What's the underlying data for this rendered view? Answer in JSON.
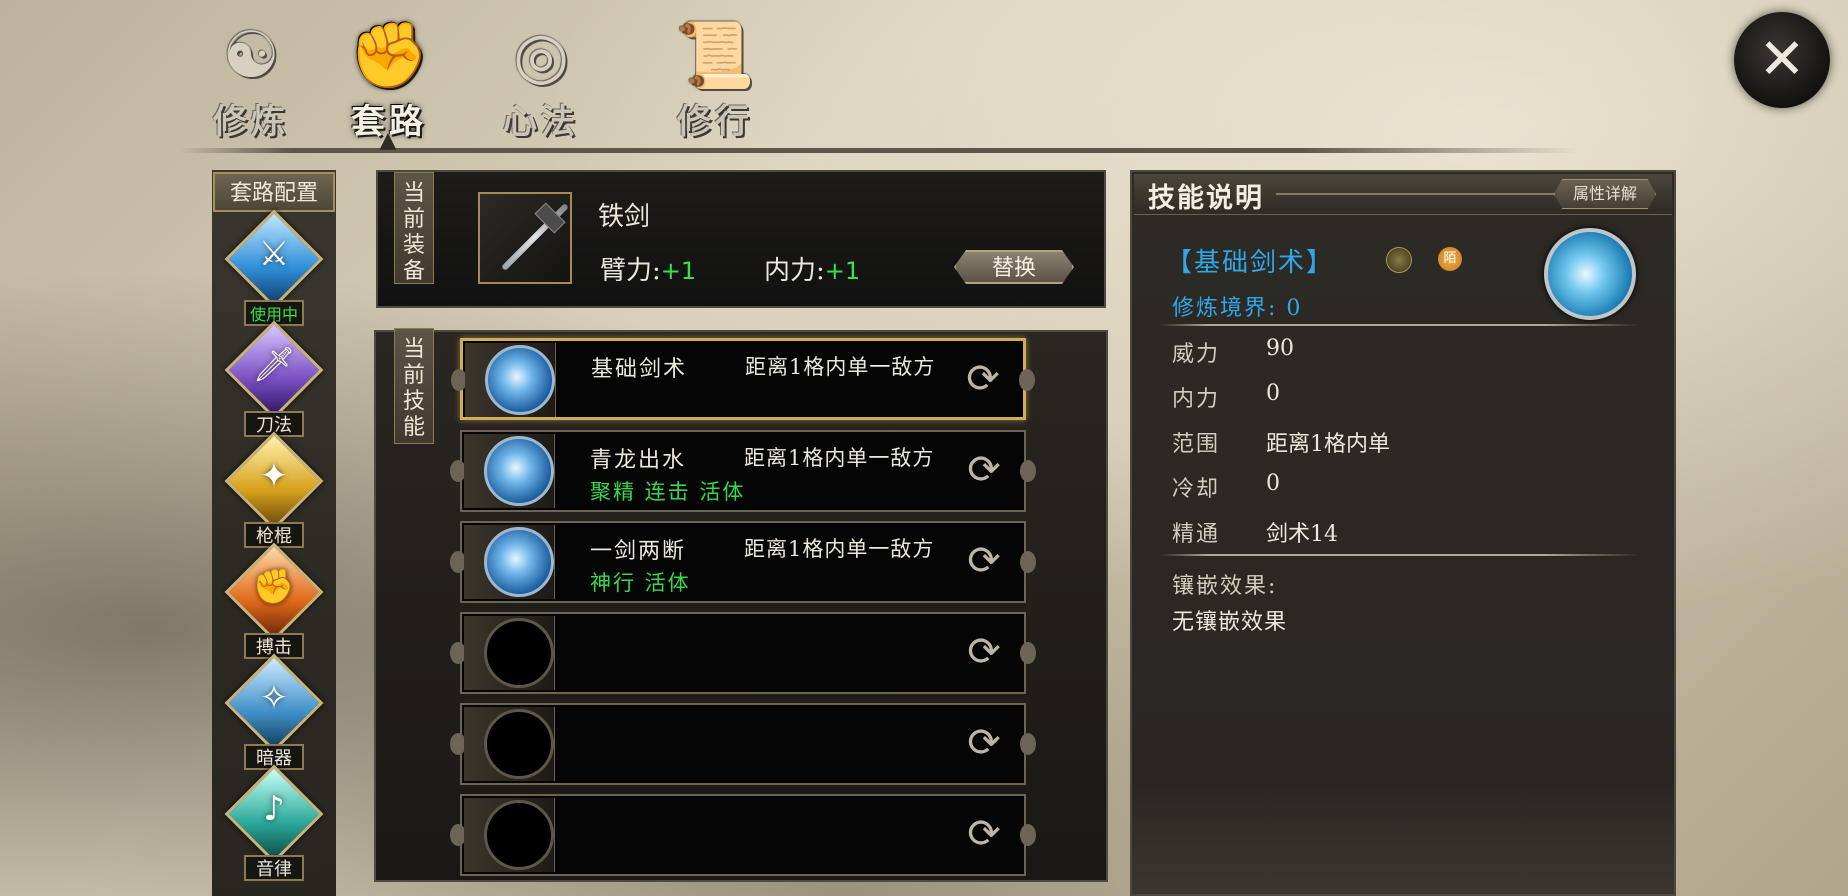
{
  "tabs": [
    {
      "label": "修炼",
      "icon": "cultivate-icon",
      "glyph": "☯"
    },
    {
      "label": "套路",
      "icon": "fist-icon",
      "glyph": "✊"
    },
    {
      "label": "心法",
      "icon": "swirl-icon",
      "glyph": "◎"
    },
    {
      "label": "修行",
      "icon": "scroll-icon",
      "glyph": "📜"
    }
  ],
  "close_label": "✕",
  "categories": {
    "title": "套路配置",
    "items": [
      {
        "label": "使用中",
        "icon": "sword-icon",
        "glyph": "⚔",
        "in_use": true,
        "color": "#2f8fd8"
      },
      {
        "label": "刀法",
        "icon": "blade-icon",
        "glyph": "🗡",
        "in_use": false,
        "color": "#7b4ec2"
      },
      {
        "label": "枪棍",
        "icon": "staff-icon",
        "glyph": "✦",
        "in_use": false,
        "color": "#d7a21c"
      },
      {
        "label": "搏击",
        "icon": "fist-icon",
        "glyph": "✊",
        "in_use": false,
        "color": "#e06a1a"
      },
      {
        "label": "暗器",
        "icon": "dart-icon",
        "glyph": "✧",
        "in_use": false,
        "color": "#3f91c9"
      },
      {
        "label": "音律",
        "icon": "music-icon",
        "glyph": "♪",
        "in_use": false,
        "color": "#2aa89a"
      }
    ]
  },
  "equipment": {
    "tag": "当前装备",
    "name": "铁剑",
    "stat1_label": "臂力:",
    "stat1_value": "+1",
    "stat2_label": "内力:",
    "stat2_value": "+1",
    "replace_label": "替换"
  },
  "skills": {
    "tag": "当前技能",
    "rows": [
      {
        "name": "基础剑术",
        "range": "距离1格内单一敌方",
        "tags": "",
        "filled": true,
        "selected": true
      },
      {
        "name": "青龙出水",
        "range": "距离1格内单一敌方",
        "tags": "聚精 连击 活体",
        "filled": true,
        "selected": false
      },
      {
        "name": "一剑两断",
        "range": "距离1格内单一敌方",
        "tags": "神行 活体",
        "filled": true,
        "selected": false
      },
      {
        "name": "",
        "range": "",
        "tags": "",
        "filled": false,
        "selected": false
      },
      {
        "name": "",
        "range": "",
        "tags": "",
        "filled": false,
        "selected": false
      },
      {
        "name": "",
        "range": "",
        "tags": "",
        "filled": false,
        "selected": false
      }
    ],
    "swap_glyph": "⟳"
  },
  "description": {
    "title": "技能说明",
    "attr_button": "属性详解",
    "skill_title": "【基础剑术】",
    "coin2_text": "陌",
    "realm": "修炼境界: 0",
    "props": [
      {
        "label": "威力",
        "value": "90"
      },
      {
        "label": "内力",
        "value": "0"
      },
      {
        "label": "范围",
        "value": "距离1格内单"
      },
      {
        "label": "冷却",
        "value": "0"
      },
      {
        "label": "精通",
        "value": "剑术14"
      }
    ],
    "inlay_label": "镶嵌效果:",
    "inlay_value": "无镶嵌效果"
  }
}
